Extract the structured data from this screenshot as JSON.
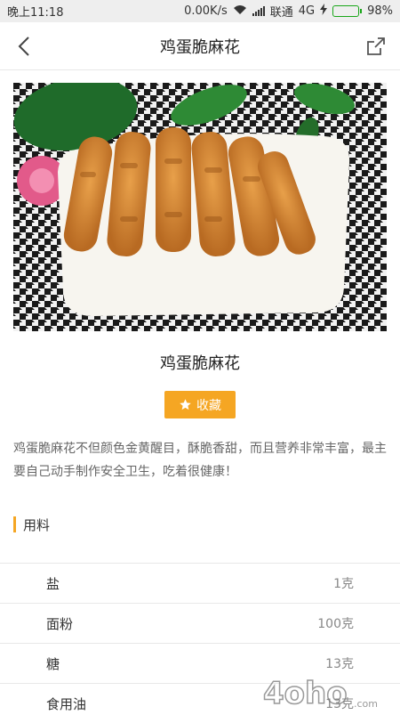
{
  "status_bar": {
    "time": "晚上11:18",
    "net_speed": "0.00K/s",
    "carrier": "联通",
    "network": "4G",
    "battery": "98%",
    "battery_level": 0.98
  },
  "nav": {
    "title": "鸡蛋脆麻花"
  },
  "recipe": {
    "title": "鸡蛋脆麻花",
    "favorite_label": "收藏",
    "description": "鸡蛋脆麻花不但颜色金黄醒目，酥脆香甜，而且营养非常丰富，最主要自己动手制作安全卫生，吃着很健康！"
  },
  "ingredients_section": {
    "label": "用料",
    "items": [
      {
        "name": "盐",
        "amount": "1克"
      },
      {
        "name": "面粉",
        "amount": "100克"
      },
      {
        "name": "糖",
        "amount": "13克"
      },
      {
        "name": "食用油",
        "amount": "13克"
      }
    ]
  },
  "watermark": {
    "text": "4oho.com"
  },
  "colors": {
    "accent": "#f5a623",
    "status_bar_bg": "#eeeeee",
    "battery_green": "#22b222"
  }
}
